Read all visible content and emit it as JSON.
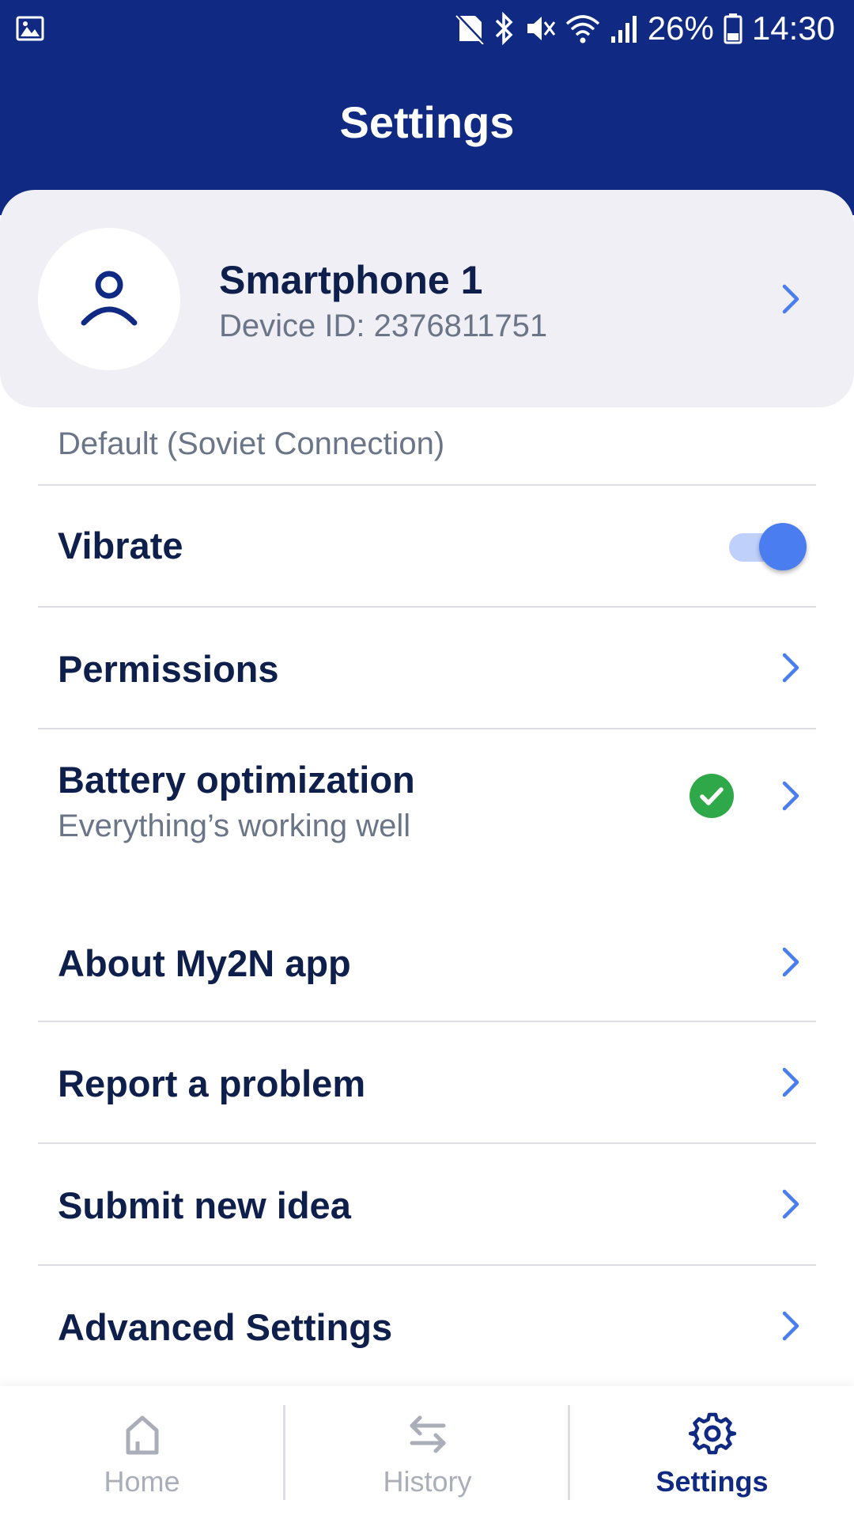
{
  "status_bar": {
    "battery_percent": "26%",
    "time": "14:30"
  },
  "header": {
    "title": "Settings"
  },
  "profile": {
    "name": "Smartphone 1",
    "device_id": "Device ID: 2376811751"
  },
  "partial_row": {
    "subtitle": "Default (Soviet Connection)"
  },
  "settings": {
    "vibrate": {
      "label": "Vibrate",
      "enabled": true
    },
    "permissions": {
      "label": "Permissions"
    },
    "battery": {
      "label": "Battery optimization",
      "subtitle": "Everything’s working well",
      "status_icon": "check-circle-icon"
    },
    "about": {
      "label": "About My2N app"
    },
    "report": {
      "label": "Report a problem"
    },
    "idea": {
      "label": "Submit new idea"
    },
    "advanced": {
      "label": "Advanced Settings"
    }
  },
  "bottom_nav": {
    "items": [
      {
        "label": "Home",
        "icon": "home-icon",
        "active": false
      },
      {
        "label": "History",
        "icon": "swap-arrows-icon",
        "active": false
      },
      {
        "label": "Settings",
        "icon": "gear-icon",
        "active": true
      }
    ]
  },
  "colors": {
    "brand_blue": "#102a83",
    "accent_blue": "#4a7ef0",
    "success_green": "#2fa84a",
    "text_dark": "#0f1f4b",
    "text_muted": "#6b7588"
  }
}
